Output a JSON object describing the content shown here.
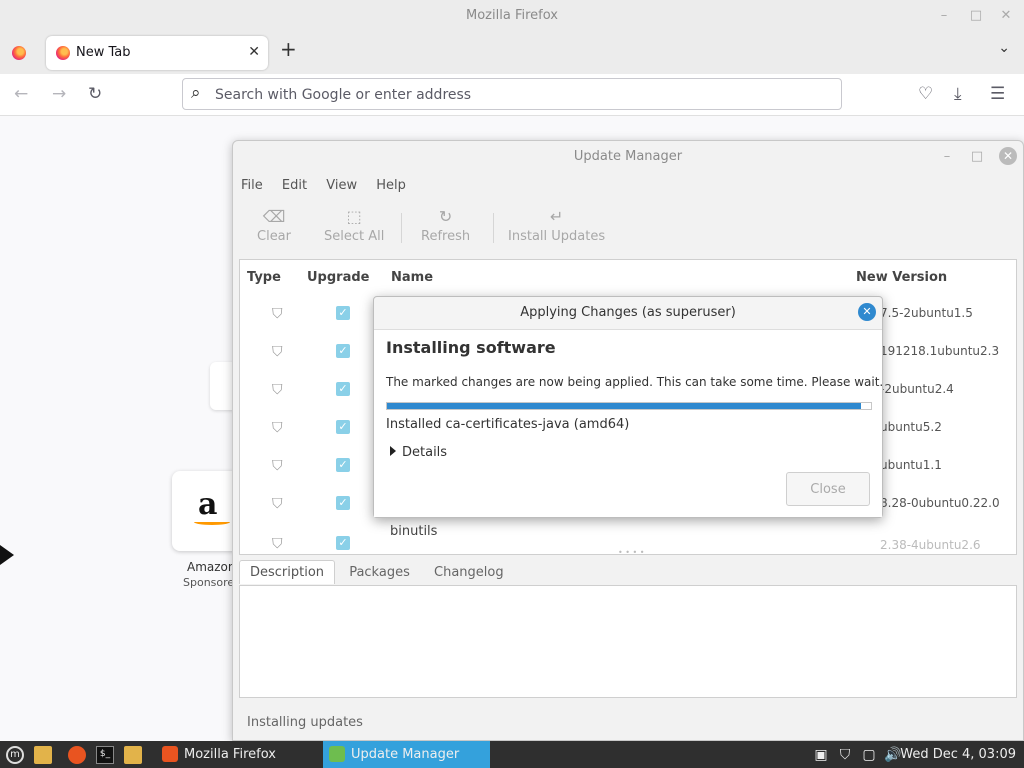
{
  "firefox": {
    "window_title": "Mozilla Firefox",
    "tab_label": "New Tab",
    "url_placeholder": "Search with Google or enter address",
    "newtab": {
      "amazon_label": "Amazon",
      "amazon_sponsored": "Sponsored",
      "amazon_logo": "a"
    }
  },
  "update_manager": {
    "title": "Update Manager",
    "menu": [
      "File",
      "Edit",
      "View",
      "Help"
    ],
    "toolbar": {
      "clear": "Clear",
      "select_all": "Select All",
      "refresh": "Refresh",
      "install_updates": "Install Updates"
    },
    "columns": {
      "type": "Type",
      "upgrade": "Upgrade",
      "name": "Name",
      "new_version": "New Version"
    },
    "rows": [
      {
        "name": "",
        "version": "7.5-2ubuntu1.5"
      },
      {
        "name": "",
        "version": "191218.1ubuntu2.3"
      },
      {
        "name": "",
        "version": "-2ubuntu2.4"
      },
      {
        "name": "",
        "version": "ubuntu5.2"
      },
      {
        "name": "",
        "version": "ubuntu1.1"
      },
      {
        "name": "",
        "version": "8.28-0ubuntu0.22.0"
      },
      {
        "name": "binutils",
        "version": "2.38-4ubuntu2.6"
      }
    ],
    "tabs": [
      "Description",
      "Packages",
      "Changelog"
    ],
    "status": "Installing updates"
  },
  "dialog": {
    "title": "Applying Changes (as superuser)",
    "heading": "Installing software",
    "message": "The marked changes are now being applied. This can take some time. Please wait.",
    "progress": 0.98,
    "status": "Installed ca-certificates-java (amd64)",
    "details": "Details",
    "close": "Close"
  },
  "taskbar": {
    "tasks": [
      {
        "label": "Mozilla Firefox"
      },
      {
        "label": "Update Manager"
      }
    ],
    "clock": "Wed Dec 4, 03:09"
  },
  "colors": {
    "accent": "#2f89cf",
    "taskbar_active": "#34a1dc",
    "check": "#8ad0e8"
  }
}
